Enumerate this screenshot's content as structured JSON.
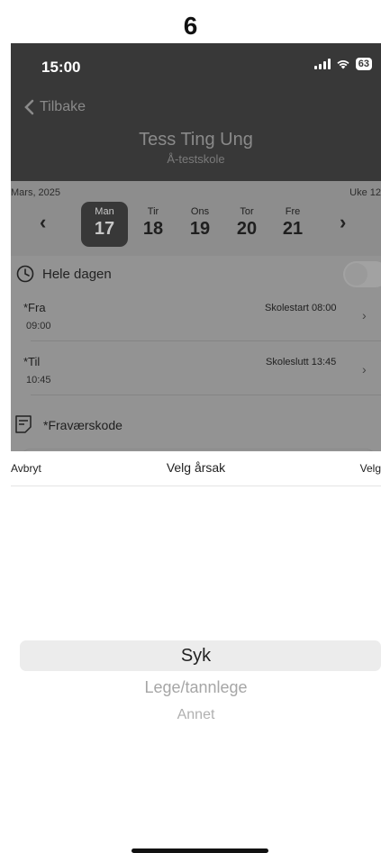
{
  "step": "6",
  "status_bar": {
    "time": "15:00",
    "battery": "63"
  },
  "header": {
    "back_label": "Tilbake",
    "name": "Tess Ting Ung",
    "school": "Å-testskole"
  },
  "calendar": {
    "month": "Mars, 2025",
    "week": "Uke 12",
    "days": [
      {
        "name": "Man",
        "num": "17",
        "selected": true
      },
      {
        "name": "Tir",
        "num": "18"
      },
      {
        "name": "Ons",
        "num": "19"
      },
      {
        "name": "Tor",
        "num": "20"
      },
      {
        "name": "Fre",
        "num": "21"
      }
    ]
  },
  "form": {
    "all_day_label": "Hele dagen",
    "all_day_enabled": false,
    "from_label": "*Fra",
    "from_value": "09:00",
    "from_hint": "Skolestart 08:00",
    "to_label": "*Til",
    "to_value": "10:45",
    "to_hint": "Skoleslutt 13:45",
    "absence_code_label": "*Fraværskode"
  },
  "picker": {
    "cancel_label": "Avbryt",
    "title": "Velg årsak",
    "confirm_label": "Velg",
    "options": [
      "Syk",
      "Lege/tannlege",
      "Annet"
    ],
    "selected": "Syk"
  },
  "colors": {
    "header_bg": "#383838",
    "dim_overlay": "#8d8d8d",
    "selected_band": "#ececec"
  }
}
